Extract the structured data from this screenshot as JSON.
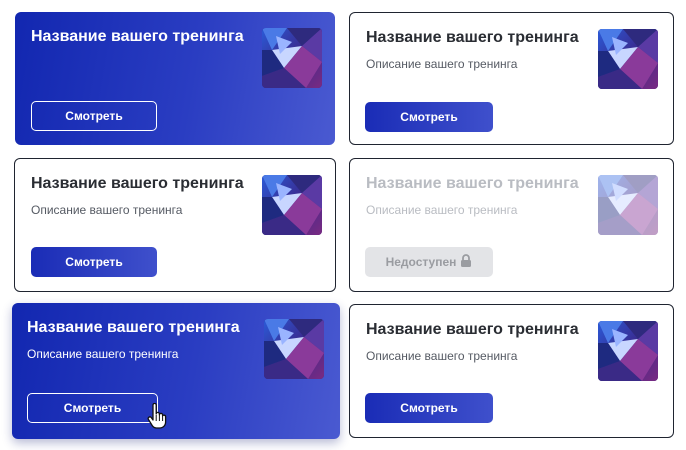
{
  "cards": [
    {
      "title": "Название вашего тренинга",
      "description": "",
      "button_label": "Смотреть"
    },
    {
      "title": "Название вашего тренинга",
      "description": "Описание вашего тренинга",
      "button_label": "Смотреть"
    },
    {
      "title": "Название вашего тренинга",
      "description": "Описание вашего тренинга",
      "button_label": "Смотреть"
    },
    {
      "title": "Название вашего тренинга",
      "description": "Описание вашего тренинга",
      "button_label": "Недоступен",
      "button_icon": "lock-icon"
    },
    {
      "title": "Название вашего тренинга",
      "description": "Описание вашего тренинга",
      "button_label": "Смотреть"
    },
    {
      "title": "Название вашего тренинга",
      "description": "Описание вашего тренинга",
      "button_label": "Смотреть"
    }
  ],
  "cursor_icon": "hand-pointer-icon",
  "colors": {
    "accent_blue": "#1a2cb6",
    "card_border": "#1f2430",
    "disabled_bg": "#e3e4e7",
    "disabled_text": "#9a9ca1"
  }
}
